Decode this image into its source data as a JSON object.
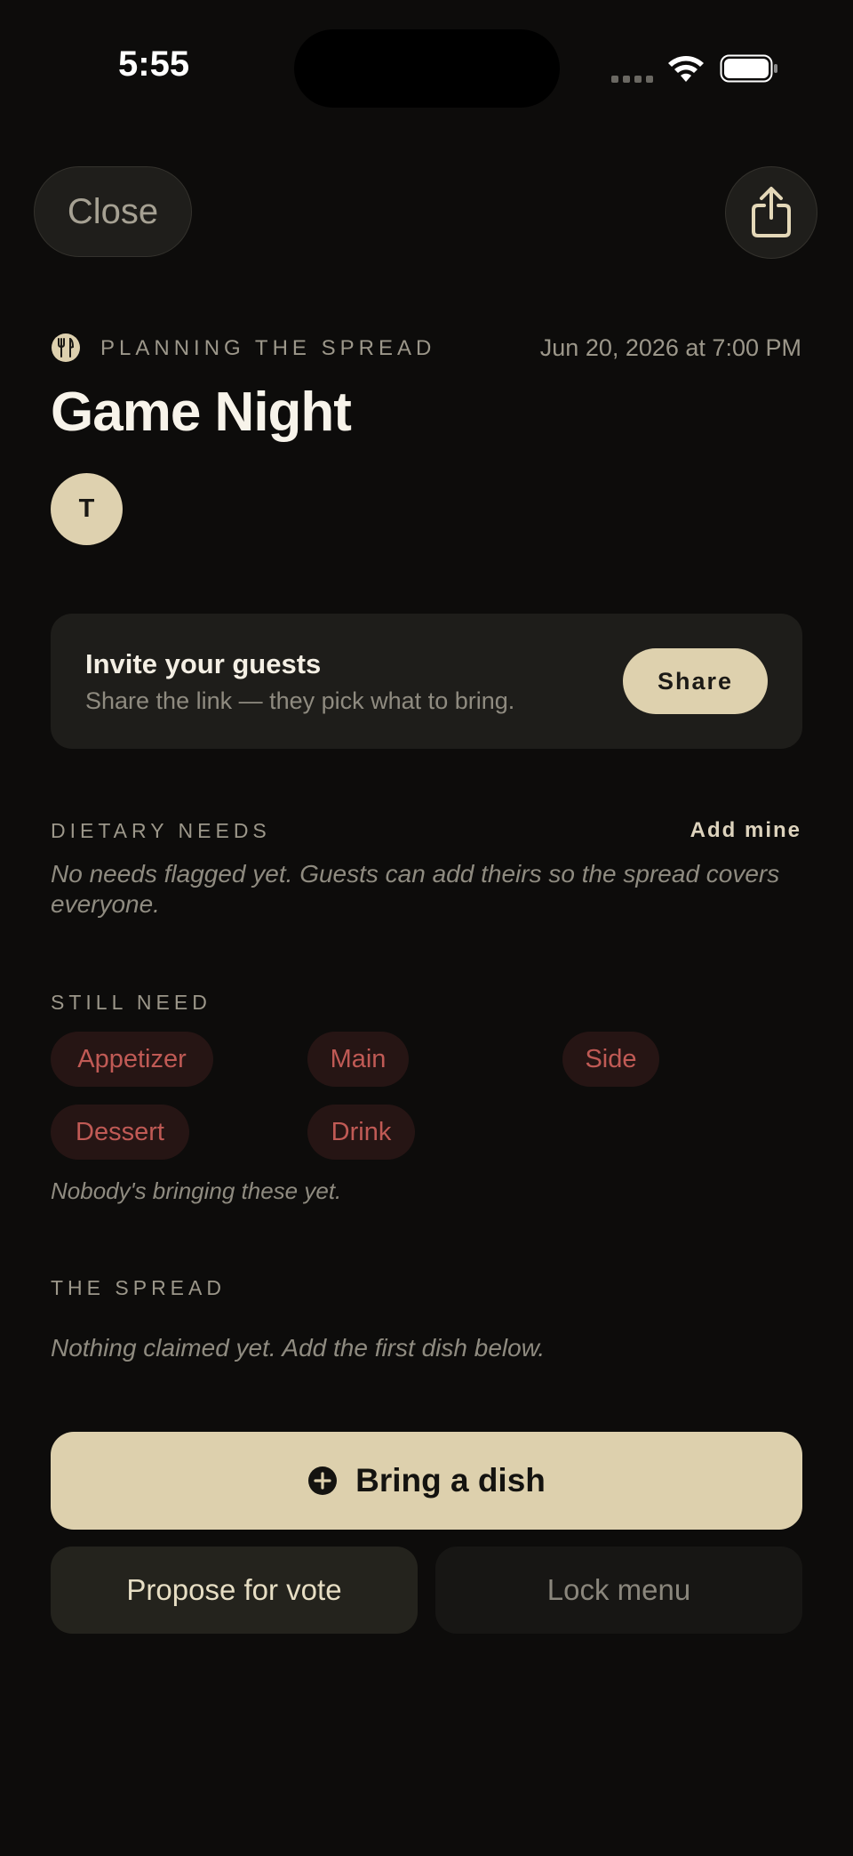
{
  "status_bar": {
    "time": "5:55"
  },
  "top_bar": {
    "close_label": "Close"
  },
  "header": {
    "status_label": "PLANNING THE SPREAD",
    "date": "Jun 20, 2026 at 7:00 PM",
    "title": "Game Night",
    "avatar_initial": "T"
  },
  "invite": {
    "title": "Invite your guests",
    "subtitle": "Share the link — they pick what to bring.",
    "share_label": "Share"
  },
  "dietary": {
    "heading": "DIETARY NEEDS",
    "add_label": "Add mine",
    "empty_note": "No needs flagged yet. Guests can add theirs so the spread covers everyone."
  },
  "still_need": {
    "heading": "STILL NEED",
    "chips": [
      "Appetizer",
      "Main",
      "Side",
      "Dessert",
      "Drink"
    ],
    "note": "Nobody's bringing these yet."
  },
  "spread": {
    "heading": "THE SPREAD",
    "empty_note": "Nothing claimed yet. Add the first dish below."
  },
  "actions": {
    "bring_label": "Bring a dish",
    "propose_label": "Propose for vote",
    "lock_label": "Lock menu"
  },
  "colors": {
    "background": "#0d0c0b",
    "accent": "#ddd0ad",
    "chip_text": "#c05a55",
    "chip_bg": "#261514"
  }
}
